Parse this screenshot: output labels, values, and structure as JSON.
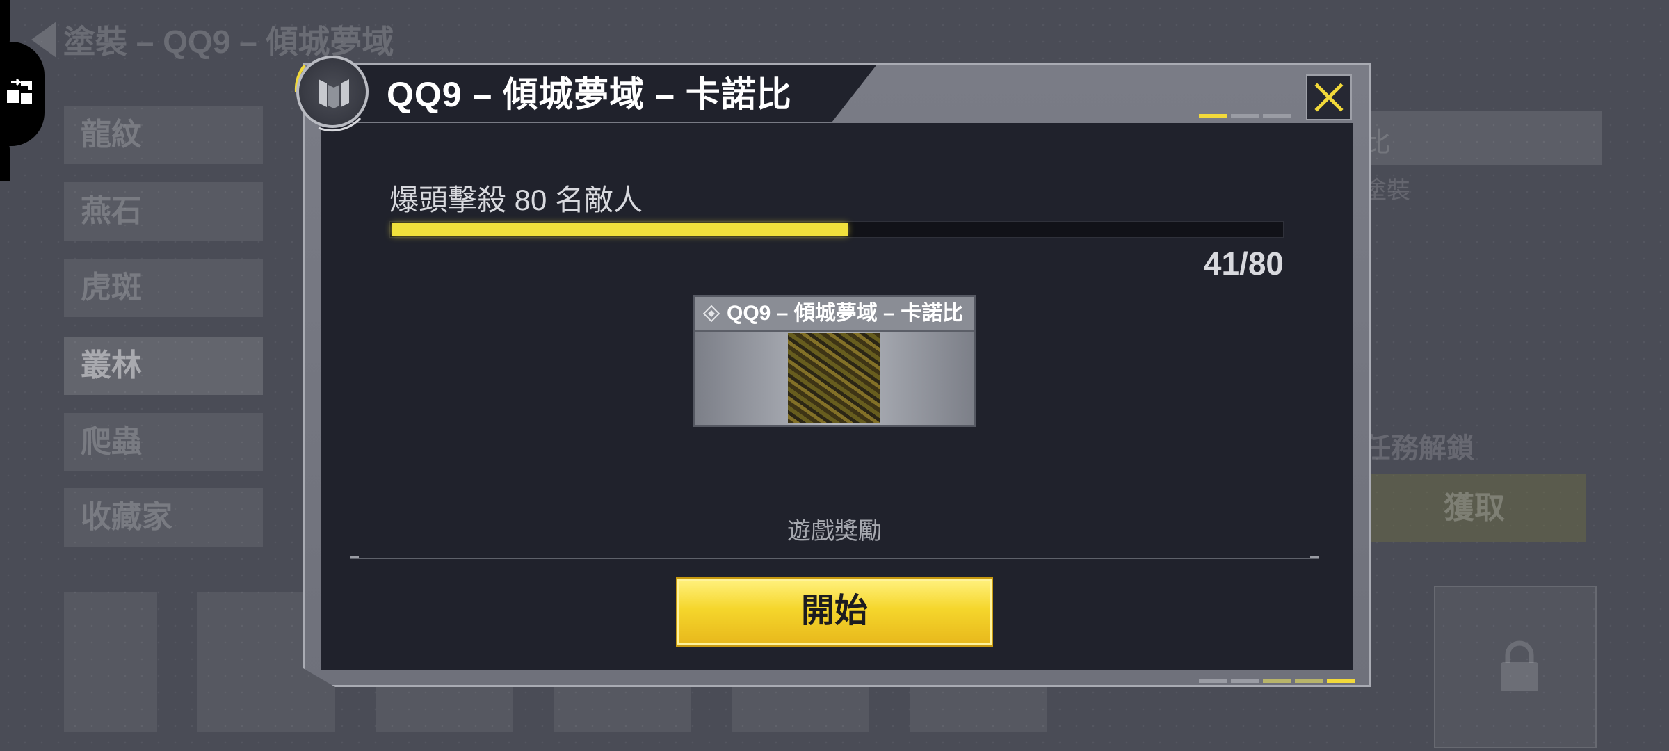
{
  "background": {
    "back_title": "塗裝 – QQ9 – 傾城夢域",
    "categories": [
      "龍紋",
      "燕石",
      "虎斑",
      "叢林",
      "爬蟲",
      "收藏家"
    ],
    "active_category_index": 3,
    "right_title": "比",
    "right_subtitle": "塗裝",
    "unlock_label": "任務解鎖",
    "get_button": "獲取"
  },
  "modal": {
    "title": "QQ9 – 傾城夢域 – 卡諾比",
    "mission_text": "爆頭擊殺 80 名敵人",
    "progress_current": 41,
    "progress_total": 80,
    "progress_text": "41/80",
    "reward": {
      "name": "QQ9 – 傾城夢域 – 卡諾比",
      "caption": "遊戲獎勵"
    },
    "start_button": "開始"
  },
  "colors": {
    "accent_yellow": "#f1e13c",
    "panel_dark": "#20222c",
    "frame_gray": "#7a7c86"
  },
  "icons": [
    "back-arrow-icon",
    "puzzle-swap-icon",
    "emblem-icon",
    "close-icon",
    "diamond-icon",
    "lock-icon"
  ]
}
